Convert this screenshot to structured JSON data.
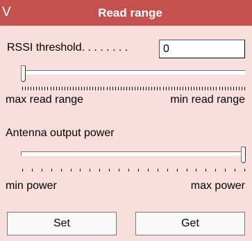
{
  "header": {
    "collapse_glyph": "V",
    "title": "Read range"
  },
  "rssi": {
    "label": "RSSI threshold",
    "leader_dots": ". . . . . . . .",
    "value": "0"
  },
  "read_range_slider": {
    "level": 0.0,
    "min_label": "max read range",
    "max_label": "min read range"
  },
  "antenna": {
    "label": "Antenna output power"
  },
  "power_slider": {
    "level": 1.0,
    "min_label": "min power",
    "max_label": "max power"
  },
  "buttons": {
    "set": "Set",
    "get": "Get"
  },
  "colors": {
    "header_bg": "#c4504f",
    "panel_bg": "#f9dede"
  }
}
